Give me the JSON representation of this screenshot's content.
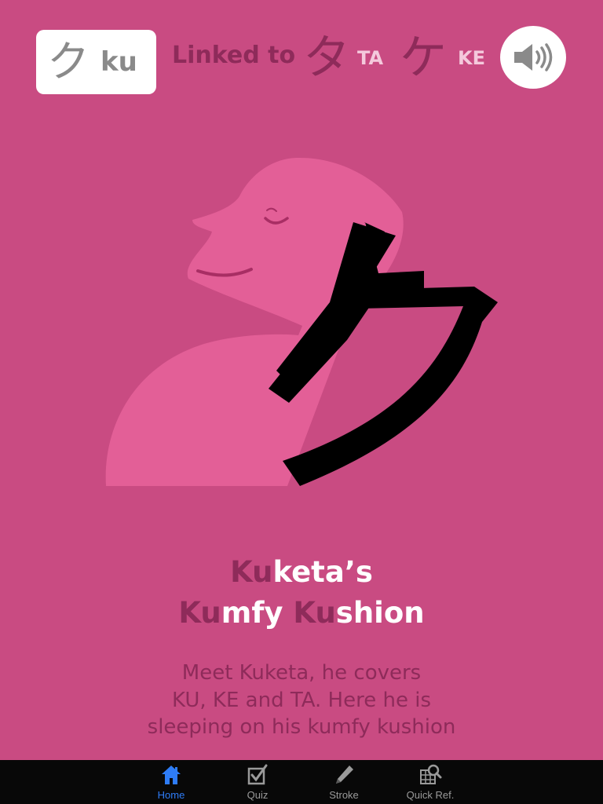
{
  "header": {
    "kana": "ク",
    "romaji": "ku",
    "linked_label": "Linked to",
    "linked": [
      {
        "kana": "タ",
        "romaji": "TA"
      },
      {
        "kana": "ケ",
        "romaji": "KE"
      }
    ],
    "sound_icon": "speaker-icon"
  },
  "illustration": {
    "figure": "sleeping-person-illustration",
    "kana": "ク"
  },
  "title": {
    "line1": [
      {
        "text": "Ku",
        "highlight": true
      },
      {
        "text": "keta’s",
        "highlight": false
      }
    ],
    "line2": [
      {
        "text": "Ku",
        "highlight": true
      },
      {
        "text": "mfy ",
        "highlight": false
      },
      {
        "text": "Ku",
        "highlight": true
      },
      {
        "text": "shion",
        "highlight": false
      }
    ]
  },
  "description": [
    "Meet Kuketa, he covers",
    "KU, KE and TA. Here he is",
    "sleeping on his kumfy kushion"
  ],
  "tabs": [
    {
      "label": "Home",
      "icon": "home-icon",
      "active": true
    },
    {
      "label": "Quiz",
      "icon": "quiz-checkbox-icon",
      "active": false
    },
    {
      "label": "Stroke",
      "icon": "pencil-icon",
      "active": false
    },
    {
      "label": "Quick Ref.",
      "icon": "grid-search-icon",
      "active": false
    }
  ],
  "colors": {
    "background": "#c94b82",
    "figure": "#e35f97",
    "highlight": "#8e2b5a",
    "active_tab": "#2e7cf6"
  }
}
